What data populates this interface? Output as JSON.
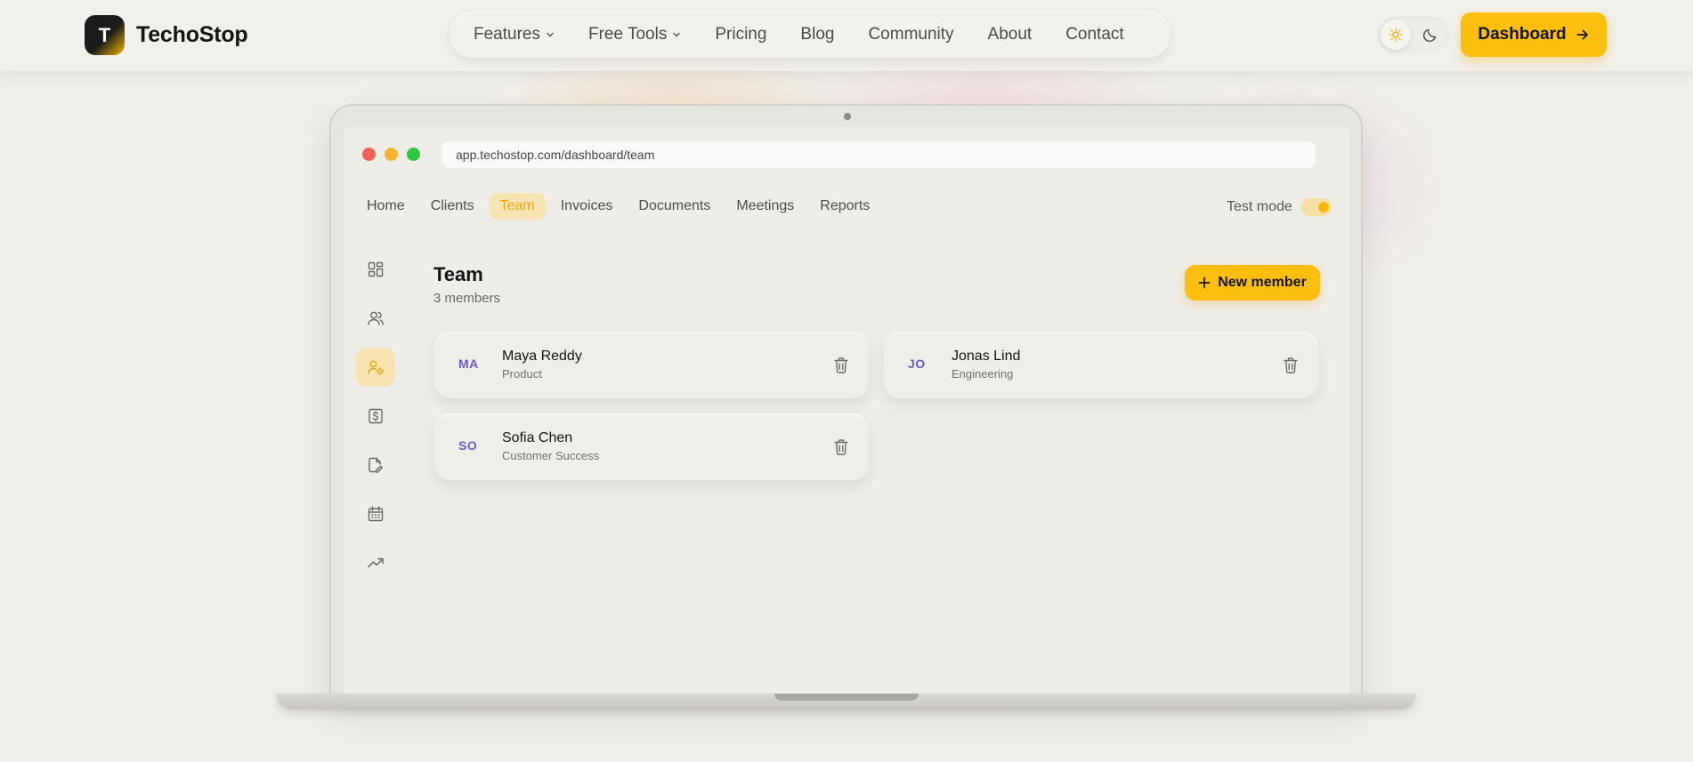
{
  "brand": {
    "logo_letter": "T",
    "name": "TechoStop"
  },
  "nav": {
    "links": [
      {
        "label": "Features",
        "dropdown": true
      },
      {
        "label": "Free Tools",
        "dropdown": true
      },
      {
        "label": "Pricing"
      },
      {
        "label": "Blog"
      },
      {
        "label": "Community"
      },
      {
        "label": "About"
      },
      {
        "label": "Contact"
      }
    ],
    "theme": {
      "current": "light",
      "icons": [
        "sun-icon",
        "moon-icon"
      ]
    },
    "dashboard_label": "Dashboard"
  },
  "browser": {
    "url": "app.techostop.com/dashboard/team"
  },
  "app": {
    "tabs": [
      {
        "label": "Home"
      },
      {
        "label": "Clients"
      },
      {
        "label": "Team",
        "active": true
      },
      {
        "label": "Invoices"
      },
      {
        "label": "Documents"
      },
      {
        "label": "Meetings"
      },
      {
        "label": "Reports"
      }
    ],
    "test_mode": {
      "label": "Test mode",
      "enabled": true
    },
    "sidebar_icons": [
      "grid-icon",
      "users-icon",
      "user-cog-icon",
      "dollar-icon",
      "file-edit-icon",
      "calendar-icon",
      "trending-up-icon"
    ],
    "page": {
      "title": "Team",
      "subtitle": "3 members",
      "new_label": "New member"
    },
    "members": [
      {
        "initials": "MA",
        "name": "Maya Reddy",
        "role": "Product"
      },
      {
        "initials": "JO",
        "name": "Jonas Lind",
        "role": "Engineering"
      },
      {
        "initials": "SO",
        "name": "Sofia Chen",
        "role": "Customer Success"
      }
    ]
  },
  "colors": {
    "accent": "#fcbf0f",
    "background": "#f0eee9",
    "initials": "#6b5bd0"
  }
}
